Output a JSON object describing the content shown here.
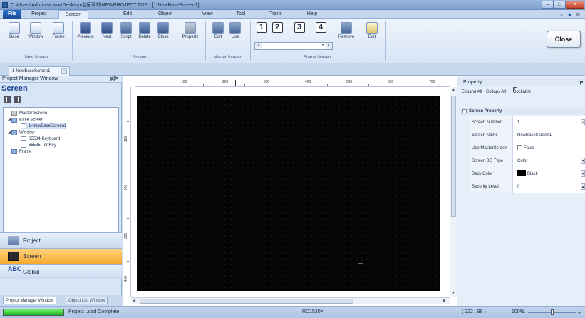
{
  "window": {
    "title": "C:\\Users\\Administrator\\Desktop\\설물작화\\NEWPROJECT.TGS - [1-NewBaseScreen1]"
  },
  "menu": {
    "file_label": "File",
    "tabs": [
      "Project",
      "Screen",
      "Edit",
      "Object",
      "View",
      "Tool",
      "Trans",
      "Help"
    ]
  },
  "ribbon": {
    "new_screen": {
      "buttons": [
        "Base",
        "Window",
        "Frame"
      ],
      "group_label": "New Screen"
    },
    "screen": {
      "buttons": [
        "Previous",
        "Next",
        "Script",
        "Delete",
        "Close",
        "Property"
      ],
      "group_label": "Screen"
    },
    "master_screen": {
      "buttons": [
        "Edit",
        "Use"
      ],
      "group_label": "Master Screen"
    },
    "frame_screen": {
      "numbers": [
        "1",
        "2",
        "3",
        "4"
      ],
      "buttons": [
        "Remove",
        "Edit"
      ],
      "group_label": "Frame Screen"
    }
  },
  "tooltip": {
    "text": "Close"
  },
  "document_tab": {
    "label": "1-NewBaseScreen1"
  },
  "project_manager": {
    "header": "Project Manager Window",
    "title": "Screen",
    "tree": [
      {
        "label": "Master Screen",
        "level": 1
      },
      {
        "label": "Base Screen",
        "level": 1
      },
      {
        "label": "1-NewBaseScreen1",
        "level": 2,
        "selected": true
      },
      {
        "label": "Window",
        "level": 1
      },
      {
        "label": "65534-Keyboard",
        "level": 2
      },
      {
        "label": "65535-TenKey",
        "level": 2
      },
      {
        "label": "Frame",
        "level": 1
      }
    ],
    "nav": [
      "Project",
      "Screen",
      "Global"
    ],
    "global_icon_text": "ABC",
    "bottom_tabs": [
      "Project Manager Window",
      "Object List Window"
    ]
  },
  "ruler": {
    "horizontal": [
      "100",
      "200",
      "300",
      "400",
      "500",
      "600",
      "700"
    ],
    "vertical": [
      "100",
      "200",
      "300",
      "400"
    ]
  },
  "property": {
    "header": "Property",
    "expand_all": "Expand All",
    "collapse_all": "Collaps All",
    "dockable": "Dockable",
    "section": "Screen Property",
    "rows": [
      {
        "name": "Screen Number",
        "value": "1"
      },
      {
        "name": "Screen Name",
        "value": "NewBaseScreen1"
      },
      {
        "name": "Use MasterScreen",
        "value": "False"
      },
      {
        "name": "Screen BG Type",
        "value": "Color"
      },
      {
        "name": "Back Color",
        "value": "Black"
      },
      {
        "name": "Security Level",
        "value": "0"
      }
    ]
  },
  "status": {
    "message": "Project Load Complete",
    "device": "RD1520X",
    "coords": "( 222 , 98 )",
    "zoom": "100%",
    "progress": 1.0
  },
  "colors": {
    "accent": "#1b4d97",
    "selected_nav": "#f7ab2f",
    "canvas_bg": "#050505",
    "progress_fill": "#1fb51f"
  }
}
